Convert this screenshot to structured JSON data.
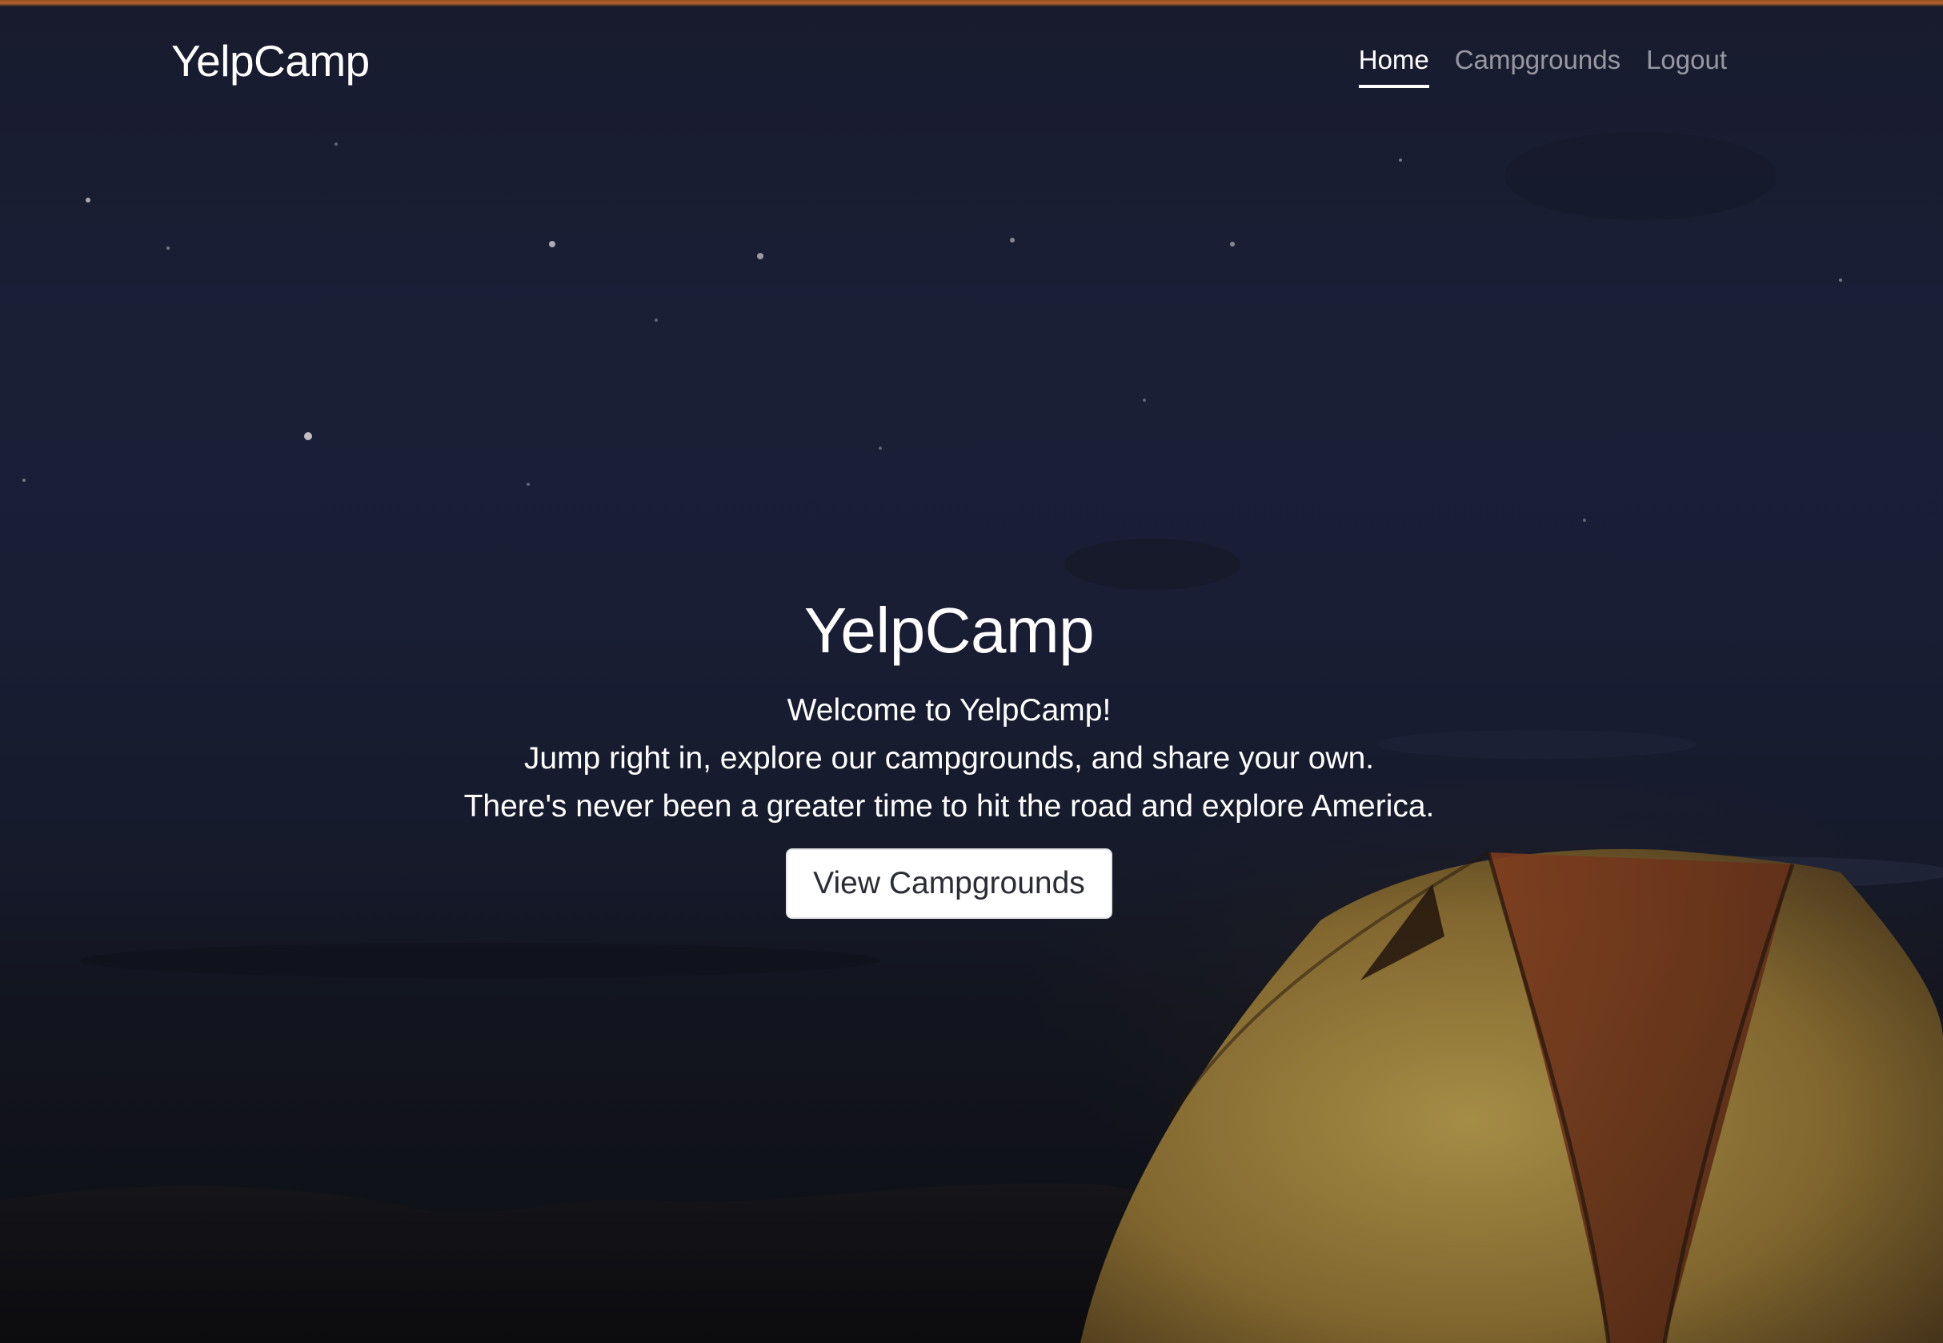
{
  "brand": "YelpCamp",
  "nav": {
    "items": [
      {
        "label": "Home",
        "active": true
      },
      {
        "label": "Campgrounds",
        "active": false
      },
      {
        "label": "Logout",
        "active": false
      }
    ]
  },
  "hero": {
    "title": "YelpCamp",
    "lines": [
      "Welcome to YelpCamp!",
      "Jump right in, explore our campgrounds, and share your own.",
      "There's never been a greater time to hit the road and explore America."
    ],
    "button_label": "View Campgrounds"
  },
  "colors": {
    "accent_bar": "#e07a37",
    "sky": "#1f2541",
    "tent": "#c9a64c",
    "text": "#ffffff"
  }
}
